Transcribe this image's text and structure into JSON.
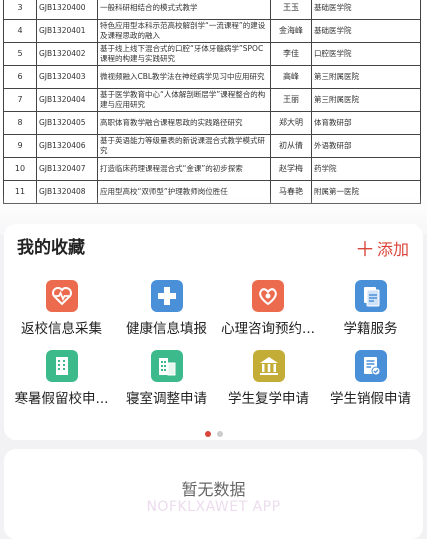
{
  "document": {
    "rows": [
      {
        "no": "3",
        "code": "GJB1320400",
        "title": "一般科研相结合的模式式教学",
        "name": "王玉",
        "org": "基础医学院"
      },
      {
        "no": "4",
        "code": "GJB1320401",
        "title": "特色应用型本科示范高校解剖学“一流课程”的建设及课程思政的融入",
        "name": "金海峰",
        "org": "基础医学院"
      },
      {
        "no": "5",
        "code": "GJB1320402",
        "title": "基于线上线下混合式的口腔“牙体牙髓病学”SPOC课程的构建与实践研究",
        "name": "李佳",
        "org": "口腔医学院"
      },
      {
        "no": "6",
        "code": "GJB1320403",
        "title": "微视频融入CBL教学法在神经病学见习中应用研究",
        "name": "高峰",
        "org": "第三附属医院"
      },
      {
        "no": "7",
        "code": "GJB1320404",
        "title": "基于医学教育中心“人体解剖断层学”课程整合的构建与应用研究",
        "name": "王丽",
        "org": "第三附属医院"
      },
      {
        "no": "8",
        "code": "GJB1320405",
        "title": "高职体育教学融合课程思政的实践路径研究",
        "name": "郑大明",
        "org": "体育教研部"
      },
      {
        "no": "9",
        "code": "GJB1320406",
        "title": "基于英语能力等级量表的新说课混合式教学模式研究",
        "name": "初从倩",
        "org": "外语教研部"
      },
      {
        "no": "10",
        "code": "GJB1320407",
        "title": "打造临床药理课程混合式“金课”的初步探索",
        "name": "赵学梅",
        "org": "药学院"
      },
      {
        "no": "11",
        "code": "GJB1320408",
        "title": "应用型高校“双师型”护理教师岗位胜任",
        "name": "马春艳",
        "org": "附属第一医院"
      }
    ]
  },
  "favorites": {
    "title": "我的收藏",
    "add_label": "添加",
    "add_icon": "plus-icon",
    "items": [
      {
        "label": "返校信息采集",
        "icon": "heart-pulse-icon",
        "color": "#ec6b4e"
      },
      {
        "label": "健康信息填报",
        "icon": "medical-cross-icon",
        "color": "#4a90d9"
      },
      {
        "label": "心理咨询预约...",
        "icon": "heart-outline-icon",
        "color": "#ec6b4e"
      },
      {
        "label": "学籍服务",
        "icon": "document-icon",
        "color": "#4a90d9"
      },
      {
        "label": "寒暑假留校申...",
        "icon": "building-icon",
        "color": "#3cba8c"
      },
      {
        "label": "寝室调整申请",
        "icon": "dormitory-icon",
        "color": "#3cba8c"
      },
      {
        "label": "学生复学申请",
        "icon": "bank-icon",
        "color": "#c3ad36"
      },
      {
        "label": "学生销假申请",
        "icon": "form-check-icon",
        "color": "#4a90d9"
      }
    ],
    "page_count": 2,
    "active_page": 1,
    "accent": "#d9453a"
  },
  "empty_section": {
    "message": "暂无数据",
    "watermark": "NOFKLXAWET APP"
  }
}
